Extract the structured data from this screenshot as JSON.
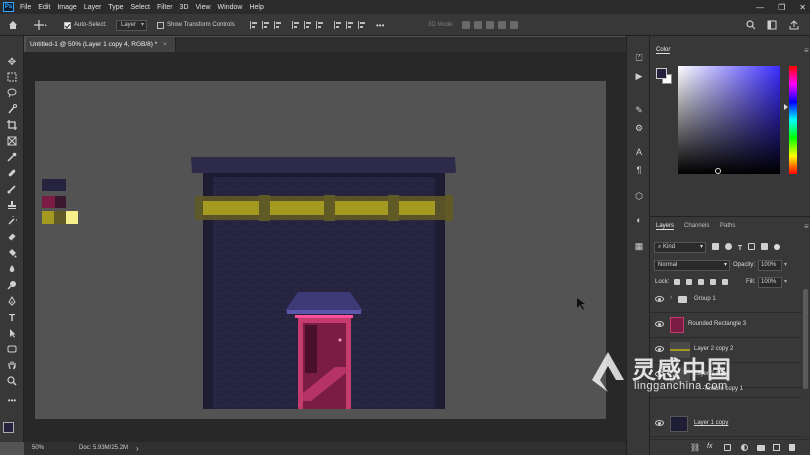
{
  "menubar": {
    "app_logo": "Ps",
    "menus": [
      "File",
      "Edit",
      "Image",
      "Layer",
      "Type",
      "Select",
      "Filter",
      "3D",
      "View",
      "Window",
      "Help"
    ],
    "window_controls": [
      "—",
      "❐",
      "✕"
    ]
  },
  "options": {
    "auto_select_label": "Auto-Select:",
    "auto_select_value": "Layer",
    "transform_controls_label": "Show Transform Controls",
    "mode_label": "3D Mode:"
  },
  "document": {
    "tab_title": "Untitled-1 @ 50% (Layer 1 copy 4, RGB/8) *",
    "tab_close": "×"
  },
  "status": {
    "zoom": "50%",
    "doc_info": "Doc: 5.93M/25.2M",
    "arrow": "›"
  },
  "color_panel": {
    "title": "Color",
    "foreground": "#25223d",
    "background": "#ffffff"
  },
  "layers_panel": {
    "tabs": [
      "Layers",
      "Channels",
      "Paths"
    ],
    "filter_label": "Kind",
    "blend_mode": "Normal",
    "opacity_label": "Opacity:",
    "opacity_value": "100%",
    "lock_label": "Lock:",
    "fill_label": "Fill:",
    "fill_value": "100%",
    "layers": [
      {
        "name": "Group 1",
        "type": "group"
      },
      {
        "name": "Rounded Rectangle 3",
        "type": "shape"
      },
      {
        "name": "Layer 2 copy 2",
        "type": "pixel"
      },
      {
        "name": "Layer 2 copy",
        "type": "pixel"
      },
      {
        "name": "Texture copy 1",
        "type": "pixel"
      },
      {
        "name": "Layer 1 copy",
        "type": "pixel"
      }
    ],
    "footer_icons": [
      "link-icon",
      "fx-icon",
      "mask-icon",
      "adjustment-icon",
      "folder-icon",
      "new-layer-icon",
      "trash-icon"
    ]
  },
  "watermark": {
    "title": "灵感中国",
    "url": "lingganchina.com"
  },
  "colors": {
    "wall": "#25233d",
    "roof": "#2e2b4a",
    "beam": "#a49a22",
    "beam_dark": "#5f5a26",
    "door": "#7a1c43",
    "door_frame": "#c63b6e",
    "awning": "#3d3a78",
    "neon": "#ff4f9a",
    "swatch_light_yellow": "#f7f08a"
  }
}
